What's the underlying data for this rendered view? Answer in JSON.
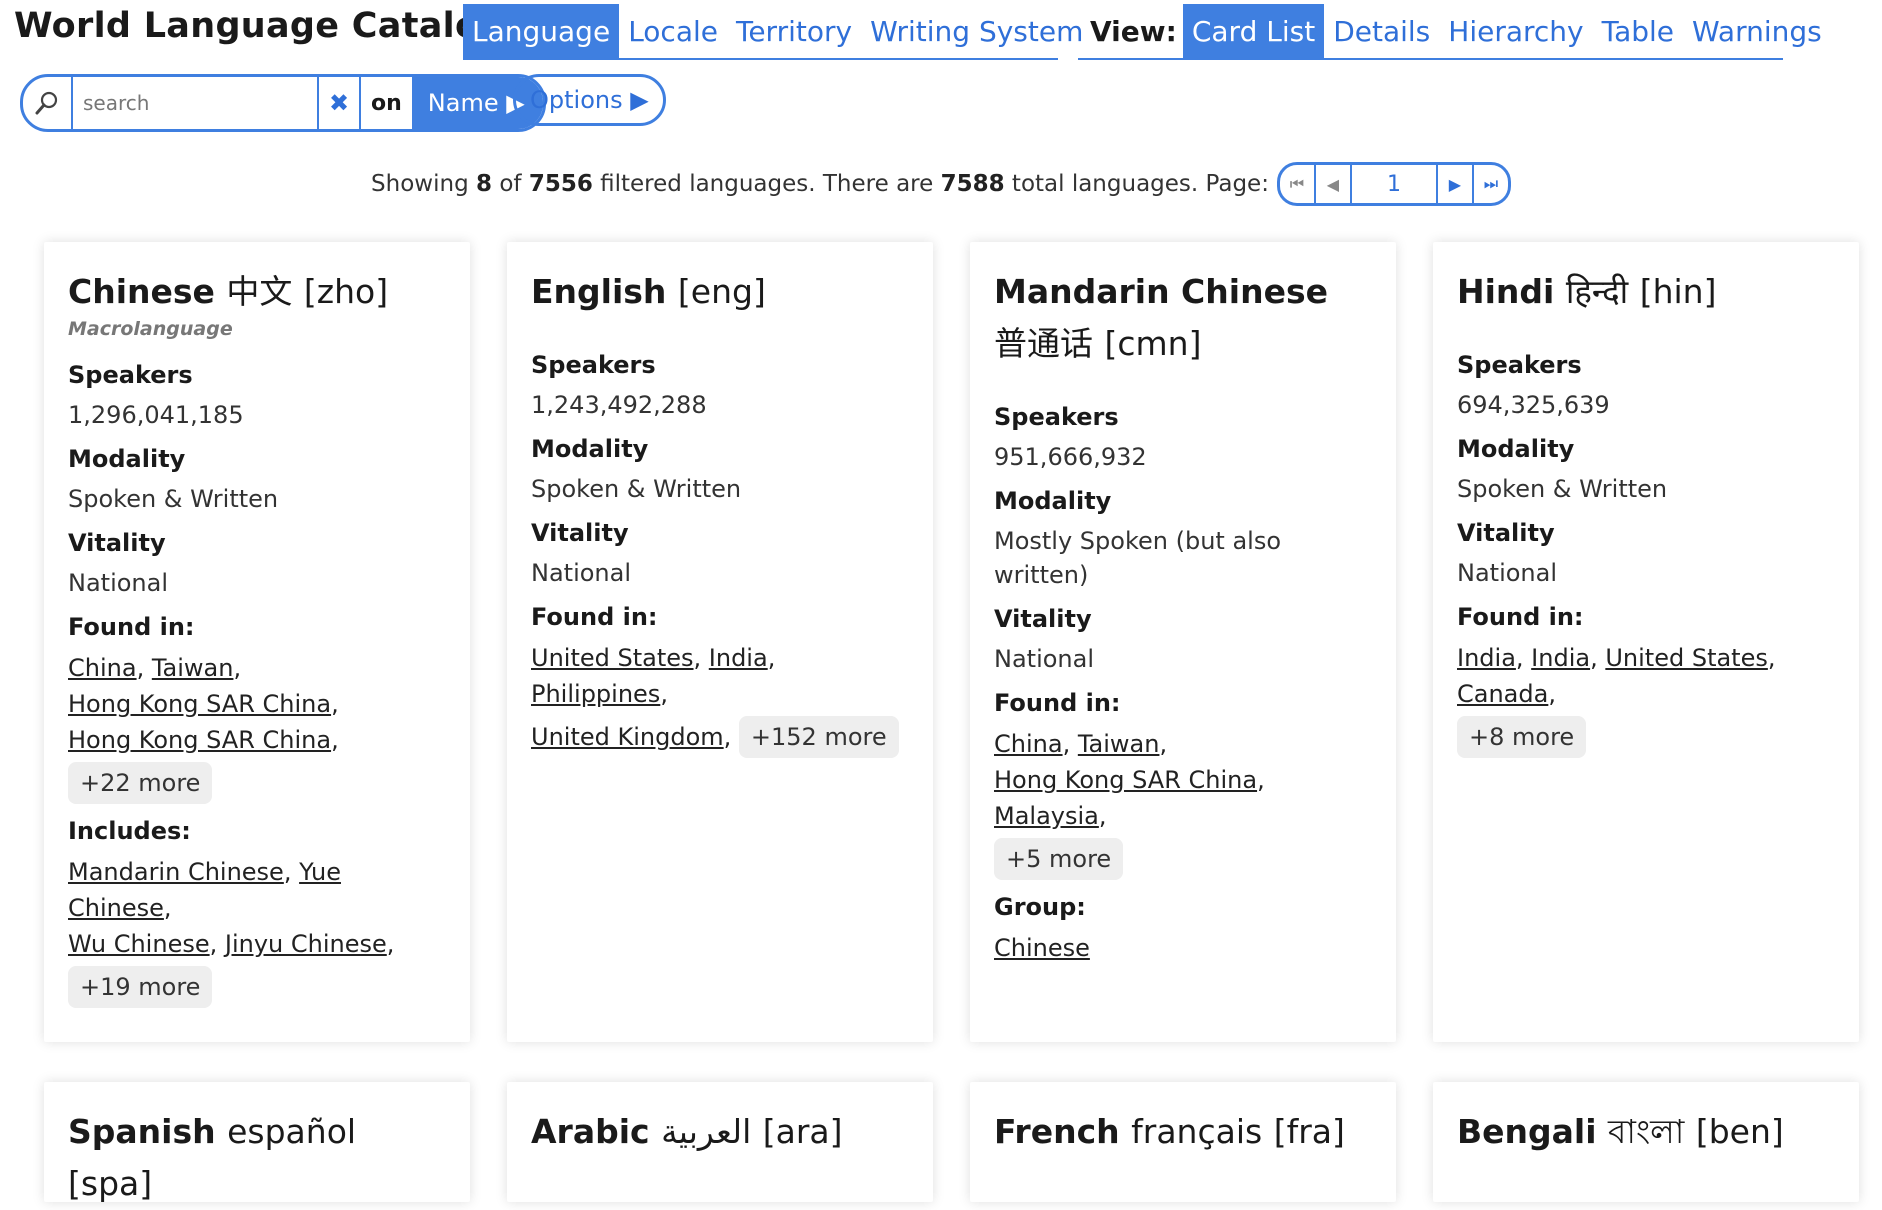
{
  "app": {
    "title": "World Language Catalog"
  },
  "entity_tabs": [
    "Language",
    "Locale",
    "Territory",
    "Writing System"
  ],
  "view": {
    "label": "View:",
    "tabs": [
      "Card List",
      "Details",
      "Hierarchy",
      "Table",
      "Warnings"
    ]
  },
  "search": {
    "placeholder": "search",
    "value": "",
    "clear_icon": "✖",
    "on_label": "on",
    "field": "Name ▶"
  },
  "options": {
    "label": "Options ▶"
  },
  "status": {
    "showing_prefix": "Showing",
    "showing": "8",
    "of": "of",
    "filtered": "7556",
    "filtered_suffix": "filtered languages. There are",
    "total": "7588",
    "total_suffix": "total languages. Page:",
    "page": "1"
  },
  "colors": {
    "accent": "#3f7fe0"
  },
  "cards": [
    {
      "name": "Chinese",
      "native": "中文",
      "code": "[zho]",
      "subtitle": "Macrolanguage",
      "speakers_label": "Speakers",
      "speakers": "1,296,041,185",
      "modality_label": "Modality",
      "modality": "Spoken & Written",
      "vitality_label": "Vitality",
      "vitality": "National",
      "found_label": "Found in:",
      "found": [
        "China",
        "Taiwan",
        "Hong Kong SAR China",
        "Hong Kong SAR China"
      ],
      "found_more": "+22 more",
      "includes_label": "Includes:",
      "includes": [
        "Mandarin Chinese",
        "Yue Chinese",
        "Wu Chinese",
        "Jinyu Chinese"
      ],
      "includes_more": "+19 more"
    },
    {
      "name": "English",
      "native": "",
      "code": "[eng]",
      "speakers_label": "Speakers",
      "speakers": "1,243,492,288",
      "modality_label": "Modality",
      "modality": "Spoken & Written",
      "vitality_label": "Vitality",
      "vitality": "National",
      "found_label": "Found in:",
      "found": [
        "United States",
        "India",
        "Philippines",
        "United Kingdom"
      ],
      "found_more": "+152 more"
    },
    {
      "name": "Mandarin Chinese",
      "native": "普通话",
      "code": "[cmn]",
      "speakers_label": "Speakers",
      "speakers": "951,666,932",
      "modality_label": "Modality",
      "modality": "Mostly Spoken (but also written)",
      "vitality_label": "Vitality",
      "vitality": "National",
      "found_label": "Found in:",
      "found": [
        "China",
        "Taiwan",
        "Hong Kong SAR China",
        "Malaysia"
      ],
      "found_more": "+5 more",
      "group_label": "Group:",
      "group": "Chinese"
    },
    {
      "name": "Hindi",
      "native": "हिन्दी",
      "code": "[hin]",
      "speakers_label": "Speakers",
      "speakers": "694,325,639",
      "modality_label": "Modality",
      "modality": "Spoken & Written",
      "vitality_label": "Vitality",
      "vitality": "National",
      "found_label": "Found in:",
      "found": [
        "India",
        "India",
        "United States",
        "Canada"
      ],
      "found_more": "+8 more"
    },
    {
      "name": "Spanish",
      "native": "español",
      "code": "[spa]"
    },
    {
      "name": "Arabic",
      "native": "العربية",
      "code": "[ara]"
    },
    {
      "name": "French",
      "native": "français",
      "code": "[fra]"
    },
    {
      "name": "Bengali",
      "native": "বাংলা",
      "code": "[ben]"
    }
  ]
}
